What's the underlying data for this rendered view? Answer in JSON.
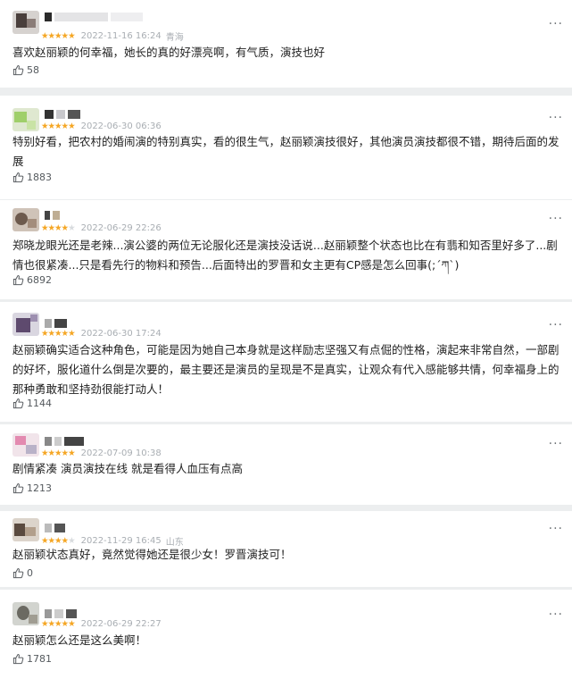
{
  "comments": [
    {
      "stars": 5,
      "date": "2022-11-16 16:24",
      "location": "青海",
      "text": "喜欢赵丽颖的何幸福，她长的真的好漂亮啊，有气质，演技也好",
      "likes": "58"
    },
    {
      "stars": 5,
      "date": "2022-06-30 06:36",
      "location": "",
      "text": "特别好看，把农村的婚闹演的特别真实，看的很生气，赵丽颖演技很好，其他演员演技都很不错，期待后面的发展",
      "likes": "1883"
    },
    {
      "stars": 4,
      "date": "2022-06-29 22:26",
      "location": "",
      "text": "郑晓龙眼光还是老辣...演公婆的两位无论服化还是演技没话说...赵丽颖整个状态也比在有翡和知否里好多了...剧情也很紧凑...只是看先行的物料和预告...后面特出的罗晋和女主更有CP感是怎么回事(;´ཀ`)",
      "likes": "6892"
    },
    {
      "stars": 5,
      "date": "2022-06-30 17:24",
      "location": "",
      "text": "赵丽颖确实适合这种角色，可能是因为她自己本身就是这样励志坚强又有点倔的性格，演起来非常自然，一部剧的好坏，服化道什么倒是次要的，最主要还是演员的呈现是不是真实，让观众有代入感能够共情，何幸福身上的那种勇敢和坚持劲很能打动人！",
      "likes": "1144"
    },
    {
      "stars": 5,
      "date": "2022-07-09 10:38",
      "location": "",
      "text": "剧情紧凑 演员演技在线 就是看得人血压有点高",
      "likes": "1213"
    },
    {
      "stars": 4,
      "date": "2022-11-29 16:45",
      "location": "山东",
      "text": "赵丽颖状态真好，竟然觉得她还是很少女！罗晋演技可！",
      "likes": "0"
    },
    {
      "stars": 5,
      "date": "2022-06-29 22:27",
      "location": "",
      "text": "赵丽颖怎么还是这么美啊！",
      "likes": "1781"
    }
  ],
  "more_icon": "···",
  "colors": {
    "star": "#f5a623",
    "star_off": "#d8dbde",
    "meta": "#a9aeb3",
    "text": "#1f1f1f"
  }
}
